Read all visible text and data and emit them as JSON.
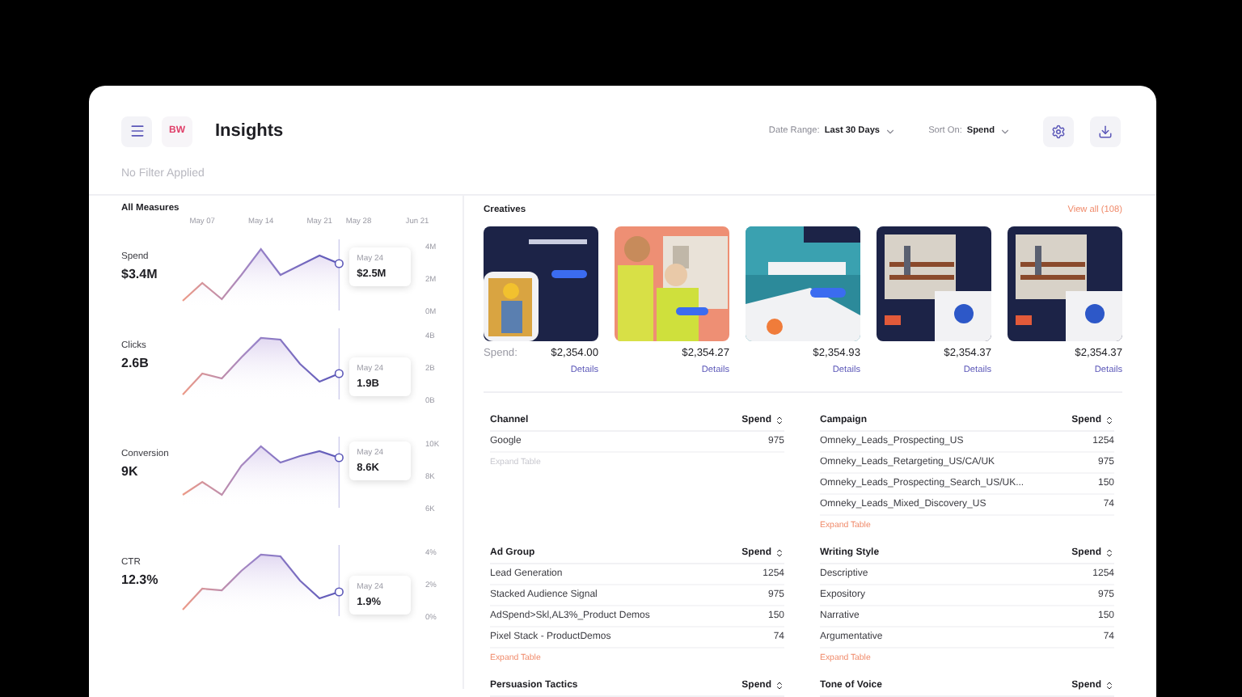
{
  "header": {
    "logo": "BW",
    "title": "Insights",
    "filters": [
      {
        "label": "Date Range:",
        "value": "Last 30 Days"
      },
      {
        "label": "Sort On:",
        "value": "Spend"
      }
    ]
  },
  "filter_status": "No Filter Applied",
  "measures": {
    "title": "All Measures",
    "items": [
      {
        "name": "Spend",
        "value": "$3.4M",
        "tooltip": {
          "date": "May 24",
          "value": "$2.5M"
        },
        "chart_data": {
          "type": "area",
          "categories": [
            null,
            "May 07",
            null,
            null,
            "May 14",
            null,
            null,
            "May 21",
            null,
            "May 28",
            null,
            null,
            "Jun 21"
          ],
          "values": [
            0.6,
            1.7,
            0.7,
            2.2,
            3.8,
            2.2,
            2.8,
            3.4,
            2.9,
            null,
            null,
            null,
            null
          ],
          "ylim": [
            0,
            4
          ],
          "yticks": [
            {
              "value": 4,
              "label": "4M"
            },
            {
              "value": 2,
              "label": "2M"
            },
            {
              "value": 0,
              "label": "0M"
            }
          ]
        }
      },
      {
        "name": "Clicks",
        "value": "2.6B",
        "tooltip": {
          "date": "May 24",
          "value": "1.9B"
        },
        "chart_data": {
          "type": "area",
          "categories": [
            null,
            null,
            null,
            null,
            null,
            null,
            null,
            null,
            null,
            null,
            null,
            null,
            null
          ],
          "values": [
            0.3,
            1.6,
            1.3,
            2.6,
            3.8,
            3.7,
            2.2,
            1.1,
            1.6,
            null,
            null,
            null,
            null
          ],
          "ylim": [
            0,
            4
          ],
          "yticks": [
            {
              "value": 4,
              "label": "4B"
            },
            {
              "value": 2,
              "label": "2B"
            },
            {
              "value": 0,
              "label": "0B"
            }
          ]
        }
      },
      {
        "name": "Conversion",
        "value": "9K",
        "tooltip": {
          "date": "May 24",
          "value": "8.6K"
        },
        "chart_data": {
          "type": "area",
          "categories": [
            null,
            null,
            null,
            null,
            null,
            null,
            null,
            null,
            null,
            null,
            null,
            null,
            null
          ],
          "values": [
            6.8,
            7.6,
            6.8,
            8.6,
            9.8,
            8.8,
            9.2,
            9.5,
            9.1,
            null,
            null,
            null,
            null
          ],
          "ylim": [
            6,
            10
          ],
          "yticks": [
            {
              "value": 10,
              "label": "10K"
            },
            {
              "value": 8,
              "label": "8K"
            },
            {
              "value": 6,
              "label": "6K"
            }
          ]
        }
      },
      {
        "name": "CTR",
        "value": "12.3%",
        "tooltip": {
          "date": "May 24",
          "value": "1.9%"
        },
        "chart_data": {
          "type": "area",
          "categories": [
            null,
            null,
            null,
            null,
            null,
            null,
            null,
            null,
            null,
            null,
            null,
            null,
            null
          ],
          "values": [
            0.4,
            1.7,
            1.6,
            2.8,
            3.8,
            3.7,
            2.2,
            1.1,
            1.5,
            null,
            null,
            null,
            null
          ],
          "ylim": [
            0,
            4
          ],
          "yticks": [
            {
              "value": 4,
              "label": "4%"
            },
            {
              "value": 2,
              "label": "2%"
            },
            {
              "value": 0,
              "label": "0%"
            }
          ]
        }
      }
    ]
  },
  "creatives": {
    "title": "Creatives",
    "view_all": "View all (108)",
    "items": [
      {
        "kind": "picture",
        "spend_label": "Spend:",
        "amount": "$2,354.00",
        "link": "Details"
      },
      {
        "kind": "picture",
        "amount": "$2,354.27",
        "link": "Details"
      },
      {
        "kind": "picture",
        "amount": "$2,354.93",
        "link": "Details"
      },
      {
        "kind": "picture",
        "amount": "$2,354.37",
        "link": "Details"
      },
      {
        "kind": "picture",
        "amount": "$2,354.37",
        "link": "Details"
      }
    ]
  },
  "tables": [
    {
      "column_1": "Channel",
      "column_2": "Spend",
      "rows": [
        [
          "Google",
          "975"
        ]
      ],
      "expand": {
        "label": "Expand Table",
        "disabled": true
      }
    },
    {
      "column_1": "Campaign",
      "column_2": "Spend",
      "rows": [
        [
          "Omneky_Leads_Prospecting_US",
          "1254"
        ],
        [
          "Omneky_Leads_Retargeting_US/CA/UK",
          "975"
        ],
        [
          "Omneky_Leads_Prospecting_Search_US/UK...",
          "150"
        ],
        [
          "Omneky_Leads_Mixed_Discovery_US",
          "74"
        ]
      ],
      "expand": {
        "label": "Expand Table",
        "disabled": false
      }
    },
    {
      "column_1": "Ad Group",
      "column_2": "Spend",
      "rows": [
        [
          "Lead Generation",
          "1254"
        ],
        [
          "Stacked Audience Signal",
          "975"
        ],
        [
          "AdSpend>Skl,AL3%_Product Demos",
          "150"
        ],
        [
          "Pixel Stack - ProductDemos",
          "74"
        ]
      ],
      "expand": {
        "label": "Expand Table",
        "disabled": false
      }
    },
    {
      "column_1": "Writing Style",
      "column_2": "Spend",
      "rows": [
        [
          "Descriptive",
          "1254"
        ],
        [
          "Expository",
          "975"
        ],
        [
          "Narrative",
          "150"
        ],
        [
          "Argumentative",
          "74"
        ]
      ],
      "expand": {
        "label": "Expand Table",
        "disabled": false
      }
    },
    {
      "column_1": "Persuasion Tactics",
      "column_2": "Spend"
    },
    {
      "column_1": "Tone of Voice",
      "column_2": "Spend"
    }
  ]
}
